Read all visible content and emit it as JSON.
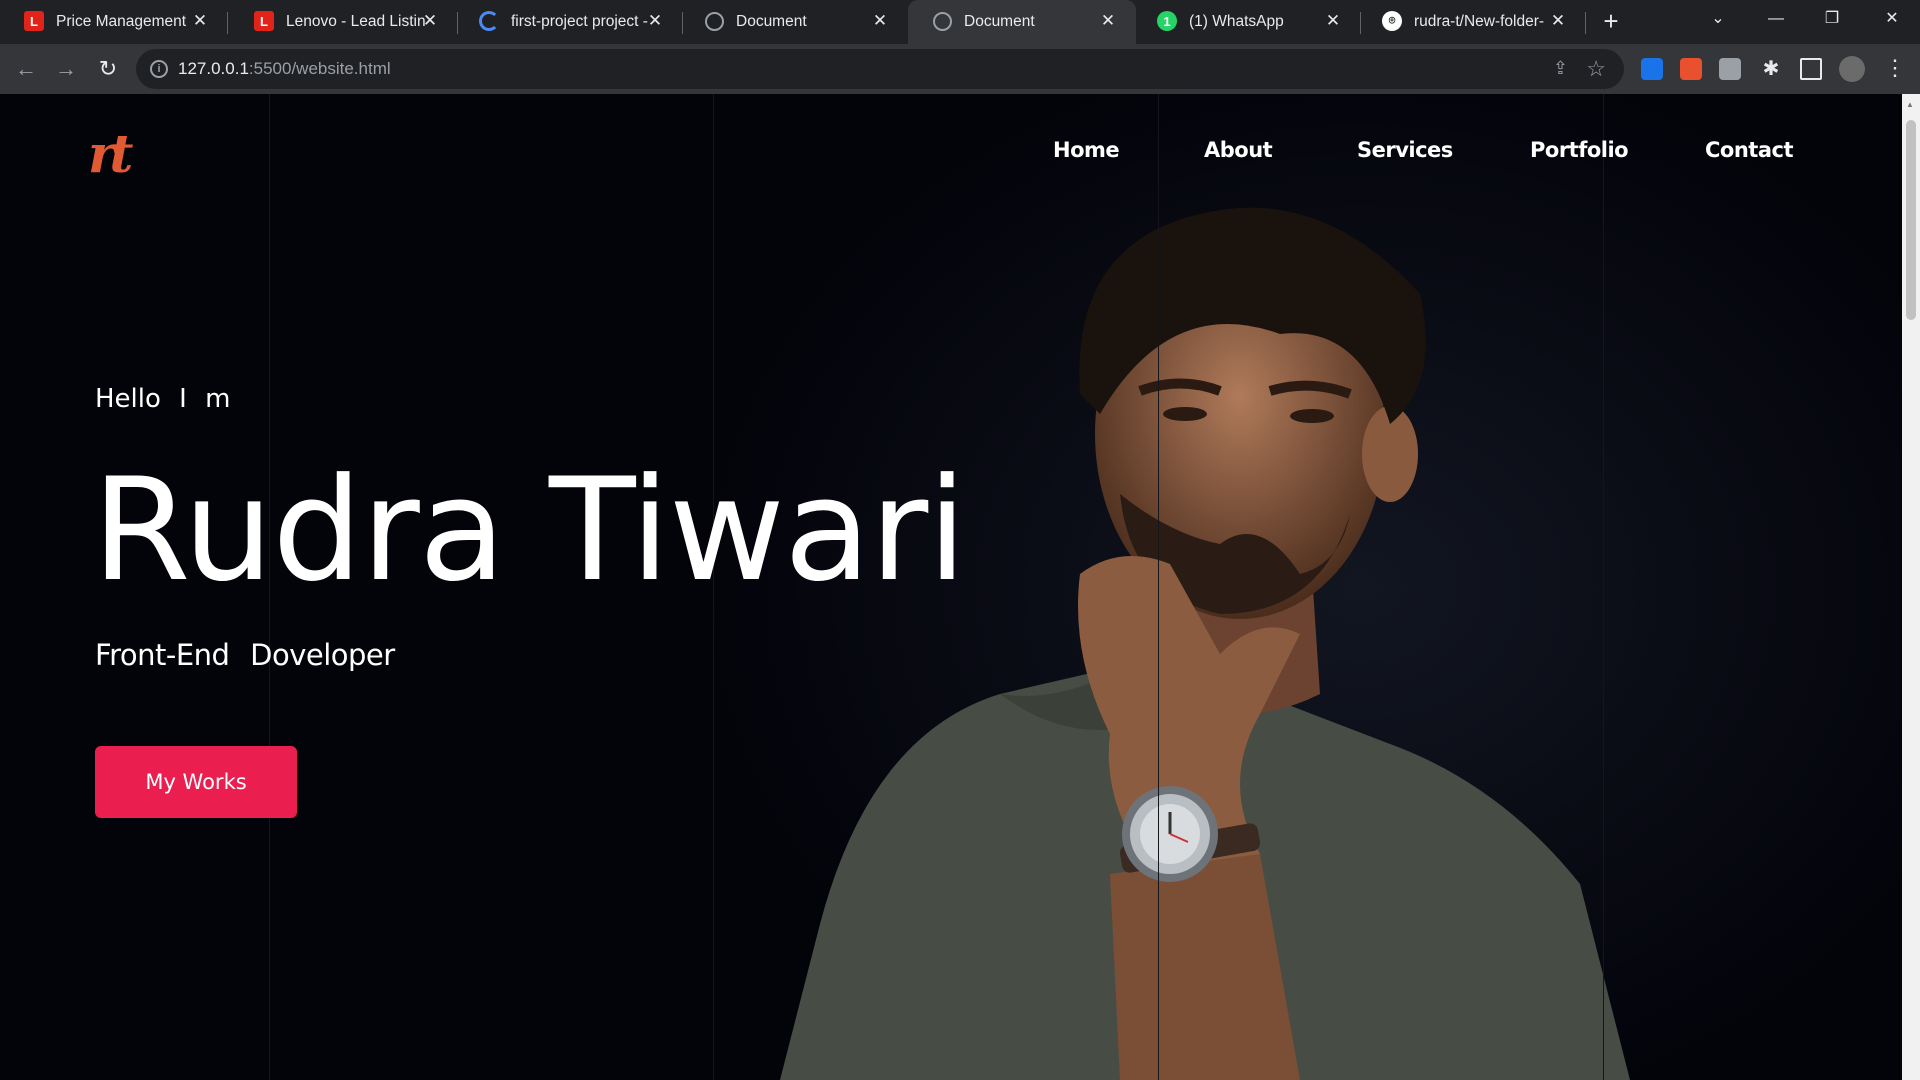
{
  "tabs": [
    {
      "title": "Price Management",
      "favicon": "lenovo-icon",
      "fav_text": "L"
    },
    {
      "title": "Lenovo - Lead Listing",
      "favicon": "lenovo-icon",
      "fav_text": "L"
    },
    {
      "title": "first-project project -",
      "favicon": "loading-spinner-icon",
      "fav_text": ""
    },
    {
      "title": "Document",
      "favicon": "globe-icon",
      "fav_text": ""
    },
    {
      "title": "Document",
      "favicon": "globe-icon",
      "fav_text": ""
    },
    {
      "title": "(1) WhatsApp",
      "favicon": "whatsapp-icon",
      "fav_text": "1"
    },
    {
      "title": "rudra-t/New-folder-",
      "favicon": "github-icon",
      "fav_text": "⌾"
    }
  ],
  "toolbar": {
    "url_host": "127.0.0.1",
    "url_path": ":5500/website.html"
  },
  "site": {
    "logo": "rt",
    "nav": [
      "Home",
      "About",
      "Services",
      "Portfolio",
      "Contact"
    ],
    "hello": "Hello I m",
    "name": "Rudra Tiwari",
    "role": "Front-End Doveloper",
    "cta": "My Works"
  },
  "colors": {
    "accent": "#ea1f4f",
    "logo": "#e05a33",
    "background": "#03030a"
  }
}
